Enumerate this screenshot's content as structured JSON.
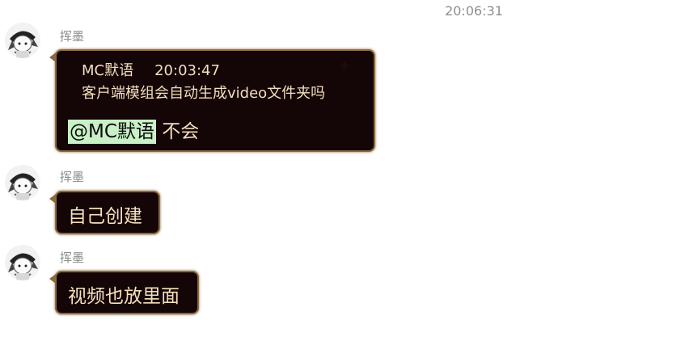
{
  "timestamp": "20:06:31",
  "messages": [
    {
      "sender": "挥墨",
      "quote": {
        "author": "MC默语",
        "time": "20:03:47",
        "text": "客户端模组会自动生成video文件夹吗"
      },
      "mention": "@MC默语",
      "text": "不会"
    },
    {
      "sender": "挥墨",
      "text": "自己创建"
    },
    {
      "sender": "挥墨",
      "text": "视频也放里面"
    }
  ],
  "colors": {
    "bubble_bg": "#140507",
    "bubble_border": "#8a6a3e",
    "bubble_text": "#f4dfbd",
    "mention_bg": "#c9f0c6",
    "sender_text": "#8c8c8c"
  }
}
